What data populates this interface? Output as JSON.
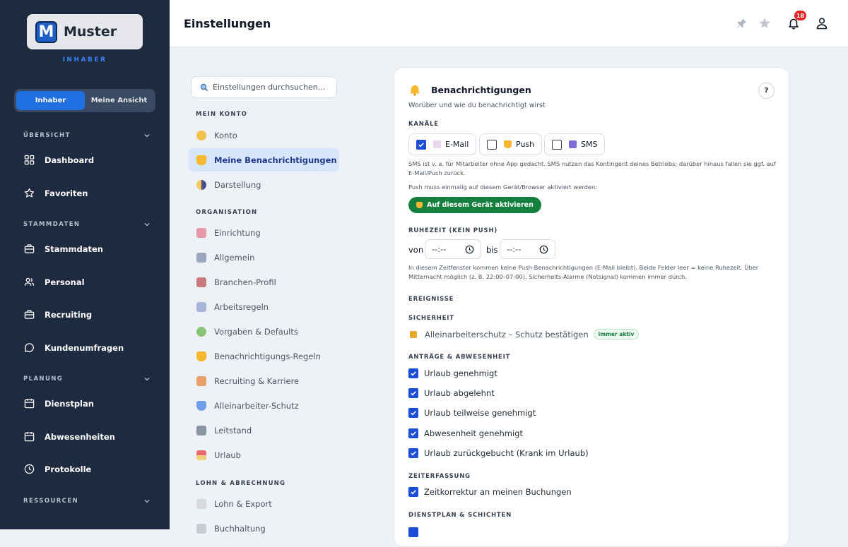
{
  "brand": {
    "name": "Muster",
    "logo_letter": "M",
    "role": "INHABER",
    "accent": "#1f6fe0",
    "sidebar_bg": "#1e2a3f"
  },
  "view_toggle": {
    "options": [
      "Inhaber",
      "Meine Ansicht"
    ],
    "selected": "Inhaber"
  },
  "sidebar": {
    "sections": [
      {
        "label": "ÜBERSICHT",
        "items": [
          {
            "label": "Dashboard",
            "icon": "grid-icon"
          },
          {
            "label": "Favoriten",
            "icon": "star-icon"
          }
        ]
      },
      {
        "label": "STAMMDATEN",
        "items": [
          {
            "label": "Stammdaten",
            "icon": "briefcase-icon"
          },
          {
            "label": "Personal",
            "icon": "users-icon"
          },
          {
            "label": "Recruiting",
            "icon": "briefcase-icon"
          },
          {
            "label": "Kundenumfragen",
            "icon": "chat-icon"
          }
        ]
      },
      {
        "label": "PLANUNG",
        "items": [
          {
            "label": "Dienstplan",
            "icon": "calendar-icon"
          },
          {
            "label": "Abwesenheiten",
            "icon": "calendar-icon"
          },
          {
            "label": "Protokolle",
            "icon": "clock-icon"
          }
        ]
      },
      {
        "label": "RESSOURCEN",
        "items": []
      }
    ]
  },
  "header": {
    "title": "Einstellungen",
    "notification_count": "18"
  },
  "settings_nav": {
    "search_placeholder": "Einstellungen durchsuchen...",
    "groups": [
      {
        "label": "MEIN KONTO",
        "items": [
          "Konto",
          "Meine Benachrichtigungen",
          "Darstellung"
        ]
      },
      {
        "label": "ORGANISATION",
        "items": [
          "Einrichtung",
          "Allgemein",
          "Branchen-Profil",
          "Arbeitsregeln",
          "Vorgaben & Defaults",
          "Benachrichtigungs-Regeln",
          "Recruiting & Karriere",
          "Alleinarbeiter-Schutz",
          "Leitstand",
          "Urlaub"
        ]
      },
      {
        "label": "LOHN & ABRECHNUNG",
        "items": [
          "Lohn & Export",
          "Buchhaltung"
        ]
      }
    ],
    "active": "Meine Benachrichtigungen"
  },
  "panel": {
    "title": "Benachrichtigungen",
    "help": "?",
    "subtitle": "Worüber und wie du benachrichtigt wirst",
    "channels_label": "KANÄLE",
    "channels": [
      {
        "label": "E-Mail",
        "checked": true
      },
      {
        "label": "Push",
        "checked": false
      },
      {
        "label": "SMS",
        "checked": false
      }
    ],
    "sms_note": "SMS ist v. a. für Mitarbeiter ohne App gedacht. SMS nutzen das Kontingent deines Betriebs; darüber hinaus fallen sie ggf. auf E-Mail/Push zurück.",
    "push_note": "Push muss einmalig auf diesem Gerät/Browser aktiviert werden:",
    "activate_button": "Auf diesem Gerät aktivieren",
    "quiet_label": "RUHEZEIT (KEIN PUSH)",
    "from_label": "von",
    "to_label": "bis",
    "time_placeholder": "--:--",
    "quiet_note": "In diesem Zeitfenster kommen keine Push-Benachrichtigungen (E-Mail bleibt). Beide Felder leer = keine Ruhezeit. Über Mitternacht möglich (z. B. 22:00–07:00). Sicherheits-Alarme (Notsignal) kommen immer durch.",
    "events_label": "EREIGNISSE",
    "security_label": "SICHERHEIT",
    "security_item": "Alleinarbeiterschutz – Schutz bestätigen",
    "security_badge": "immer aktiv",
    "absence_label": "ANTRÄGE & ABWESENHEIT",
    "absence_items": [
      "Urlaub genehmigt",
      "Urlaub abgelehnt",
      "Urlaub teilweise genehmigt",
      "Abwesenheit genehmigt",
      "Urlaub zurückgebucht (Krank im Urlaub)"
    ],
    "time_label": "ZEITERFASSUNG",
    "time_items": [
      "Zeitkorrektur an meinen Buchungen"
    ],
    "shift_label": "DIENSTPLAN & SCHICHTEN"
  }
}
